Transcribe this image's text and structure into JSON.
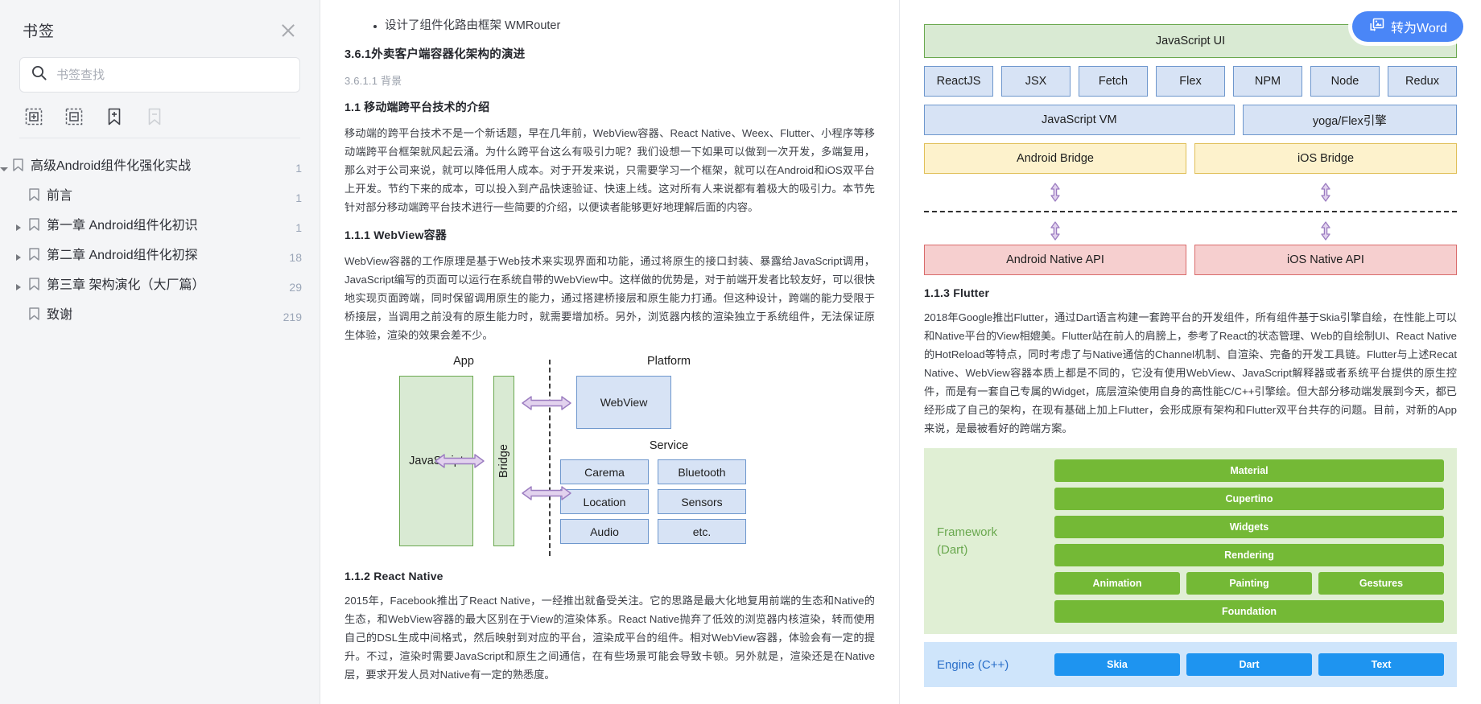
{
  "sidebar": {
    "title": "书签",
    "close_icon": "close-icon",
    "search": {
      "placeholder": "书签查找",
      "value": "",
      "icon": "search-icon"
    },
    "tools": [
      {
        "name": "expand-all-button",
        "icon": "box-plus-icon",
        "disabled": false
      },
      {
        "name": "collapse-all-button",
        "icon": "box-minus-icon",
        "disabled": false
      },
      {
        "name": "add-bookmark-button",
        "icon": "bookmark-plus-icon",
        "disabled": false
      },
      {
        "name": "remove-bookmark-button",
        "icon": "bookmark-minus-icon",
        "disabled": true
      }
    ],
    "tree": [
      {
        "label": "高级Android组件化强化实战",
        "page": "1",
        "level": 0,
        "twisty": "down",
        "icon": "bookmark-icon"
      },
      {
        "label": "前言",
        "page": "1",
        "level": 1,
        "twisty": "none",
        "icon": "bookmark-icon"
      },
      {
        "label": "第一章 Android组件化初识",
        "page": "1",
        "level": 1,
        "twisty": "right",
        "icon": "bookmark-icon"
      },
      {
        "label": "第二章 Android组件化初探",
        "page": "18",
        "level": 1,
        "twisty": "right",
        "icon": "bookmark-icon"
      },
      {
        "label": "第三章 架构演化（大厂篇）",
        "page": "29",
        "level": 1,
        "twisty": "right",
        "icon": "bookmark-icon"
      },
      {
        "label": "致谢",
        "page": "219",
        "level": 1,
        "twisty": "none",
        "icon": "bookmark-icon"
      }
    ]
  },
  "word_button": {
    "label": "转为Word",
    "icon": "convert-word-icon",
    "color": "#4a86f7"
  },
  "doc": {
    "left": {
      "bullet": "设计了组件化路由框架 WMRouter",
      "h_major": "3.6.1外卖客户端容器化架构的演进",
      "h_sub": "3.6.1.1 背景",
      "h_minor_1": "1.1 移动端跨平台技术的介绍",
      "para_1": "移动端的跨平台技术不是一个新话题，早在几年前，WebView容器、React Native、Weex、Flutter、小程序等移动端跨平台框架就风起云涌。为什么跨平台这么有吸引力呢？我们设想一下如果可以做到一次开发，多端复用，那么对于公司来说，就可以降低用人成本。对于开发来说，只需要学习一个框架，就可以在Android和iOS双平台上开发。节约下来的成本，可以投入到产品快速验证、快速上线。这对所有人来说都有着极大的吸引力。本节先针对部分移动端跨平台技术进行一些简要的介绍，以便读者能够更好地理解后面的内容。",
      "h_minor_2": "1.1.1 WebView容器",
      "para_2": "WebView容器的工作原理是基于Web技术来实现界面和功能，通过将原生的接口封装、暴露给JavaScript调用，JavaScript编写的页面可以运行在系统自带的WebView中。这样做的优势是，对于前端开发者比较友好，可以很快地实现页面跨端，同时保留调用原生的能力，通过搭建桥接层和原生能力打通。但这种设计，跨端的能力受限于桥接层，当调用之前没有的原生能力时，就需要增加桥。另外，浏览器内核的渲染独立于系统组件，无法保证原生体验，渲染的效果会差不少。",
      "h_minor_3": "1.1.2 React Native",
      "para_3": "2015年，Facebook推出了React Native，一经推出就备受关注。它的思路是最大化地复用前端的生态和Native的生态，和WebView容器的最大区别在于View的渲染体系。React Native抛弃了低效的浏览器内核渲染，转而使用自己的DSL生成中间格式，然后映射到对应的平台，渲染成平台的组件。相对WebView容器，体验会有一定的提升。不过，渲染时需要JavaScript和原生之间通信，在有些场景可能会导致卡顿。另外就是，渲染还是在Native层，要求开发人员对Native有一定的熟悉度。",
      "figure": {
        "caption_app": "App",
        "caption_platform": "Platform",
        "caption_service": "Service",
        "js_box": "JavaScript",
        "bridge_box": "Bridge",
        "webview_box": "WebView",
        "services": [
          "Carema",
          "Bluetooth",
          "Location",
          "Sensors",
          "Audio",
          "etc."
        ]
      }
    },
    "right": {
      "rn_figure": {
        "top_bar": "JavaScript UI",
        "modules": [
          "ReactJS",
          "JSX",
          "Fetch",
          "Flex",
          "NPM",
          "Node",
          "Redux"
        ],
        "vm_left": "JavaScript VM",
        "vm_right": "yoga/Flex引擎",
        "bridges": [
          "Android Bridge",
          "iOS Bridge"
        ],
        "natives": [
          "Android Native API",
          "iOS Native API"
        ]
      },
      "h_minor_flutter": "1.1.3 Flutter",
      "para_flutter": "2018年Google推出Flutter，通过Dart语言构建一套跨平台的开发组件，所有组件基于Skia引擎自绘，在性能上可以和Native平台的View相媲美。Flutter站在前人的肩膀上，参考了React的状态管理、Web的自绘制UI、React Native的HotReload等特点，同时考虑了与Native通信的Channel机制、自渲染、完备的开发工具链。Flutter与上述Recat Native、WebView容器本质上都是不同的，它没有使用WebView、JavaScript解释器或者系统平台提供的原生控件，而是有一套自己专属的Widget，底层渲染使用自身的高性能C/C++引擎绘。但大部分移动端发展到今天，都已经形成了自己的架构，在现有基础上加上Flutter，会形成原有架构和Flutter双平台共存的问题。目前，对新的App来说，是最被看好的跨端方案。",
      "flutter_figure": {
        "framework_label": "Framework\n(Dart)",
        "framework_rows": [
          "Material",
          "Cupertino",
          "Widgets",
          "Rendering"
        ],
        "framework_triple": [
          "Animation",
          "Painting",
          "Gestures"
        ],
        "framework_foundation": "Foundation",
        "engine_label": "Engine (C++)",
        "engine_items": [
          "Skia",
          "Dart",
          "Text"
        ]
      }
    }
  }
}
